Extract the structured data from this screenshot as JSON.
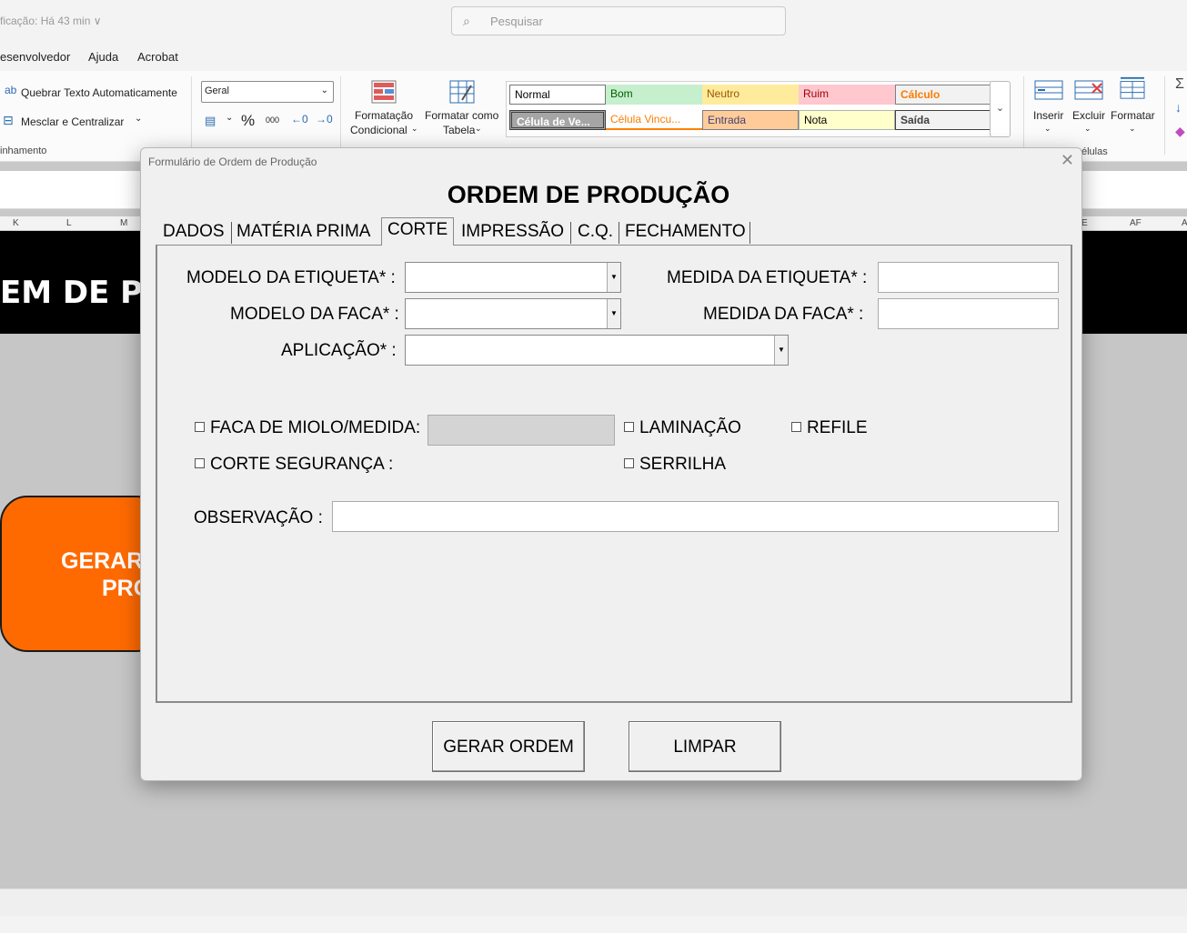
{
  "titlebar": {
    "status": "ficação: Há 43 min ∨",
    "search_placeholder": "Pesquisar"
  },
  "menu": [
    "esenvolvedor",
    "Ajuda",
    "Acrobat"
  ],
  "ribbon": {
    "wrap_text": "Quebrar Texto Automaticamente",
    "merge_center": "Mesclar e Centralizar",
    "alignment_group": "inhamento",
    "number_format": "Geral",
    "percent": "%",
    "thousands": "000",
    "cond_format_1": "Formatação",
    "cond_format_2": "Condicional",
    "format_table_1": "Formatar como",
    "format_table_2": "Tabela",
    "styles": {
      "normal": "Normal",
      "bom": "Bom",
      "neutro": "Neutro",
      "ruim": "Ruim",
      "calculo": "Cálculo",
      "celula_ve": "Célula de Ve...",
      "celula_vinc": "Célula Vincu...",
      "entrada": "Entrada",
      "nota": "Nota",
      "saida": "Saída"
    },
    "inserir": "Inserir",
    "excluir": "Excluir",
    "formatar": "Formatar",
    "cells_group": "élulas"
  },
  "columns": [
    "K",
    "L",
    "M",
    "E",
    "AF",
    "A"
  ],
  "sheet": {
    "banner": "EM DE PR",
    "orange_line1": "GERAR",
    "orange_line2": "PRO"
  },
  "dialog": {
    "title": "Formulário de Ordem de Produção",
    "heading": "ORDEM DE PRODUÇÃO",
    "tabs": [
      "DADOS",
      "MATÉRIA PRIMA",
      "CORTE",
      "IMPRESSÃO",
      "C.Q.",
      "FECHAMENTO"
    ],
    "active_tab": "CORTE",
    "fields": {
      "modelo_etiqueta": "MODELO DA ETIQUETA* :",
      "medida_etiqueta": "MEDIDA DA ETIQUETA* :",
      "modelo_faca": "MODELO DA FACA* :",
      "medida_faca": "MEDIDA DA FACA* :",
      "aplicacao": "APLICAÇÃO* :",
      "faca_miolo": "FACA DE MIOLO/MEDIDA:",
      "laminacao": "LAMINAÇÃO",
      "refile": "REFILE",
      "corte_seguranca": "CORTE SEGURANÇA :",
      "serrilha": "SERRILHA",
      "observacao": "OBSERVAÇÃO :"
    },
    "buttons": {
      "gerar": "GERAR ORDEM",
      "limpar": "LIMPAR"
    }
  }
}
